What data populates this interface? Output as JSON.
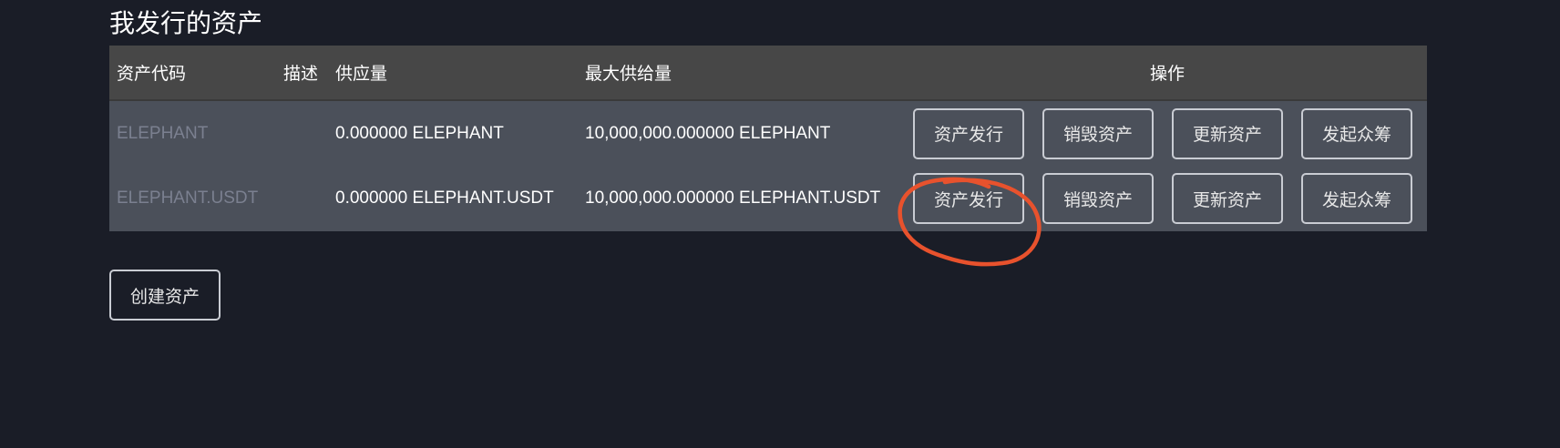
{
  "page": {
    "title": "我发行的资产"
  },
  "table": {
    "headers": {
      "code": "资产代码",
      "description": "描述",
      "supply": "供应量",
      "max_supply": "最大供给量",
      "operations": "操作"
    },
    "rows": [
      {
        "code": "ELEPHANT",
        "description": "",
        "supply": "0.000000 ELEPHANT",
        "max_supply": "10,000,000.000000 ELEPHANT"
      },
      {
        "code": "ELEPHANT.USDT",
        "description": "",
        "supply": "0.000000 ELEPHANT.USDT",
        "max_supply": "10,000,000.000000 ELEPHANT.USDT"
      }
    ],
    "actions": {
      "issue": "资产发行",
      "burn": "销毁资产",
      "update": "更新资产",
      "crowdfund": "发起众筹"
    }
  },
  "create_button": "创建资产",
  "colors": {
    "background": "#1a1d27",
    "header_row": "#474747",
    "body_row": "#4b505a",
    "annotation": "#e8522d"
  }
}
